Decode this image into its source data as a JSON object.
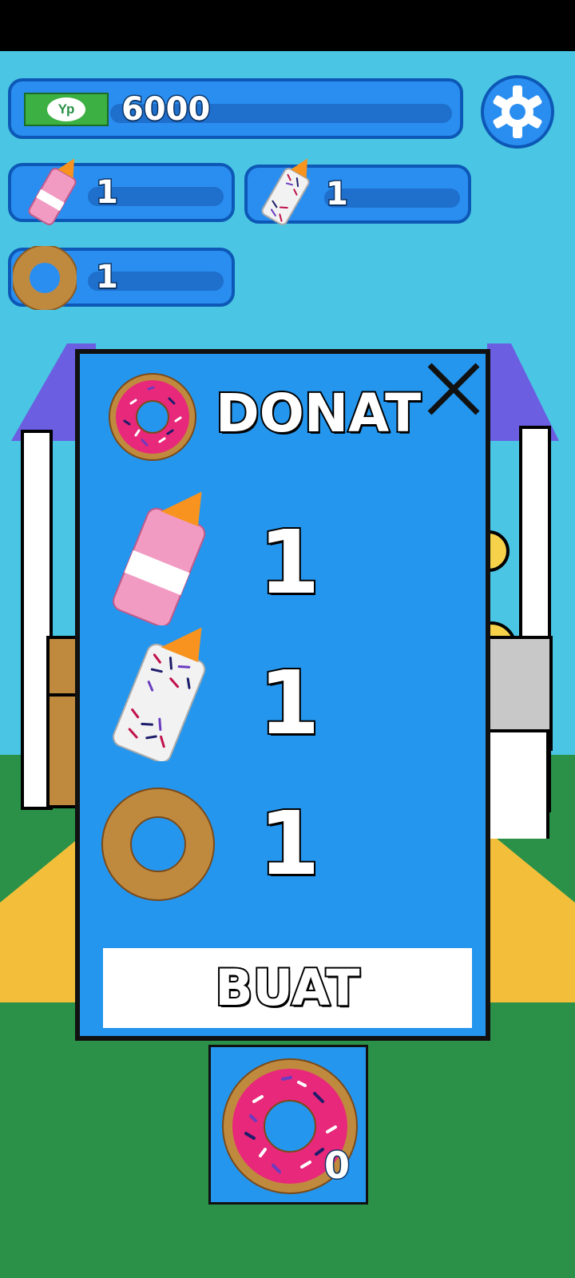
{
  "hud": {
    "currency_icon_text": "Yp",
    "money": "6000",
    "pink_icing_count": "1",
    "sprinkle_icing_count": "1",
    "donut_base_count": "1",
    "settings_icon": "gear-icon"
  },
  "recipe_modal": {
    "title": "DONAT",
    "close_icon": "close-icon",
    "ingredients": [
      {
        "name": "pink-icing-bottle-icon",
        "qty": "1"
      },
      {
        "name": "sprinkle-icing-bottle-icon",
        "qty": "1"
      },
      {
        "name": "donut-base-icon",
        "qty": "1"
      }
    ],
    "make_button": "BUAT"
  },
  "output_slot": {
    "item_icon": "frosted-donut-icon",
    "count": "0"
  },
  "colors": {
    "sky": "#4ac6e4",
    "grass": "#2b9148",
    "panel": "#2496ee",
    "bar_border": "#0d58b6",
    "awning": "#6b5ee0",
    "currency_green": "#3cb043"
  }
}
